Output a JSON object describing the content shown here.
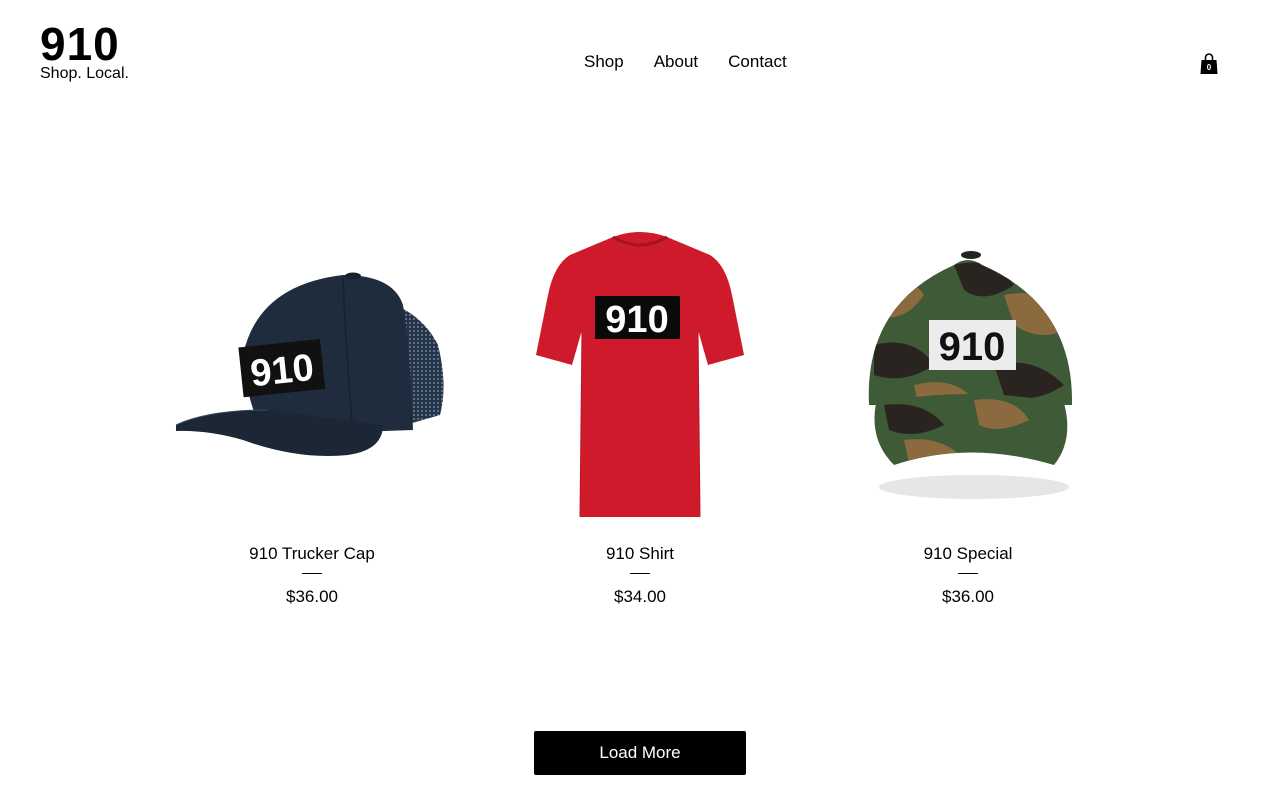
{
  "header": {
    "logo_title": "910",
    "logo_tagline": "Shop. Local.",
    "nav": [
      {
        "label": "Shop"
      },
      {
        "label": "About"
      },
      {
        "label": "Contact"
      }
    ],
    "cart_count": "0",
    "cart_icon": "shopping-bag-icon"
  },
  "products": [
    {
      "name": "910 Trucker Cap",
      "price": "$36.00",
      "image": "navy-trucker-cap",
      "patch_text": "910",
      "color": "#1f2c3d"
    },
    {
      "name": "910 Shirt",
      "price": "$34.00",
      "image": "red-tshirt",
      "patch_text": "910",
      "color": "#cf1a2b"
    },
    {
      "name": "910 Special",
      "price": "$36.00",
      "image": "camo-dad-hat",
      "patch_text": "910",
      "color": "#4a5a3a"
    }
  ],
  "load_more_label": "Load More"
}
